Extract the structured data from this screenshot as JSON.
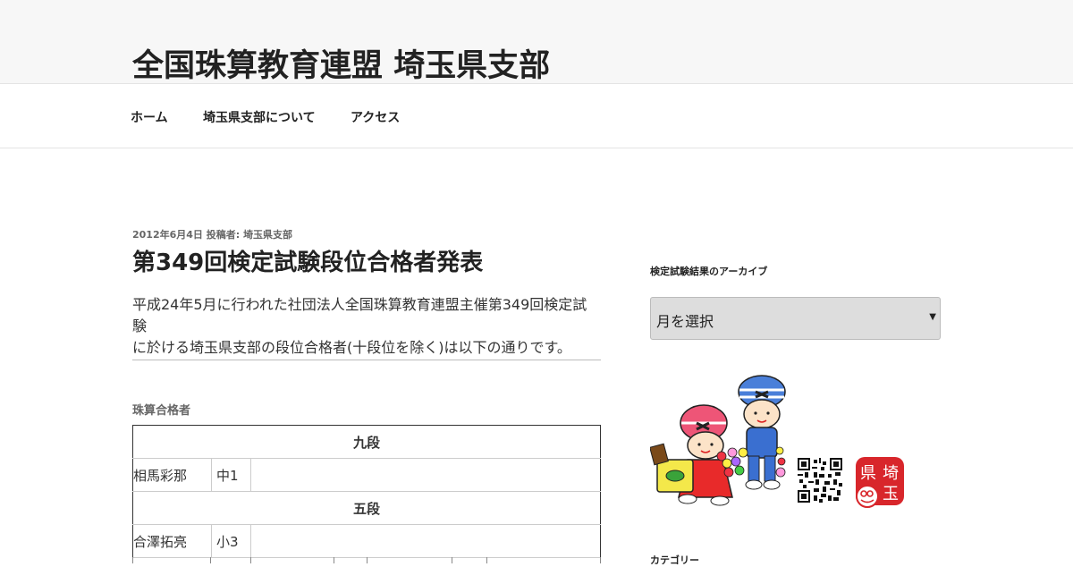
{
  "site": {
    "title": "全国珠算教育連盟 埼玉県支部"
  },
  "nav": {
    "items": [
      "ホーム",
      "埼玉県支部について",
      "アクセス"
    ]
  },
  "post": {
    "meta": "2012年6月4日 投稿者: 埼玉県支部",
    "title": "第349回検定試験段位合格者発表",
    "body_line1": "平成24年5月に行われた社団法人全国珠算教育連盟主催第349回検定試験",
    "body_line2": "に於ける埼玉県支部の段位合格者(十段位を除く)は以下の通りです。",
    "section_heading": "珠算合格者",
    "results": [
      {
        "grade": "九段",
        "name": "相馬彩那",
        "school": "中1"
      },
      {
        "grade": "五段",
        "name": "合澤拓亮",
        "school": "小3"
      }
    ]
  },
  "sidebar": {
    "archive_title": "検定試験結果のアーカイブ",
    "archive_select": "月を選択",
    "stamp_text": [
      "県",
      "埼",
      "玉"
    ],
    "category_title": "カテゴリー"
  },
  "colors": {
    "stamp_red": "#d8262b",
    "header_bg": "#f7f7f7",
    "select_bg": "#dddddd"
  }
}
